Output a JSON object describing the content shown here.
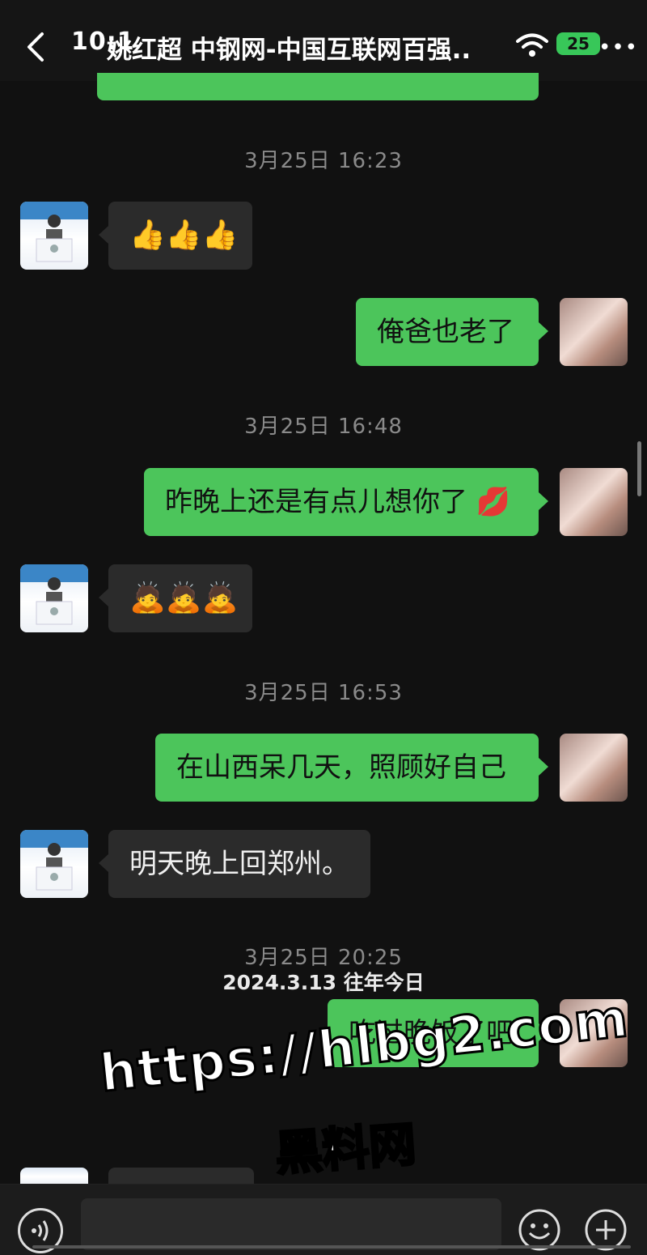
{
  "header": {
    "status_time": "10:1",
    "title": "姚红超 中钢网-中国互联网百强..",
    "battery": "25"
  },
  "colors": {
    "outgoing_bubble": "#4cc55b",
    "incoming_bubble": "#2b2b2b",
    "background": "#111111"
  },
  "messages": {
    "ts1": "3月25日 16:23",
    "m1": "👍👍👍",
    "m2": "俺爸也老了",
    "ts2": "3月25日 16:48",
    "m3": "昨晚上还是有点儿想你了 💋",
    "m4": "🙇🙇🙇",
    "ts3": "3月25日 16:53",
    "m5": "在山西呆几天，照顾好自己",
    "m6": "明天晚上回郑州。",
    "ts4": "3月25日 20:25",
    "memory_tag": "2024.3.13 往年今日",
    "m7": "吃过晚饭了吧"
  },
  "watermark": {
    "line1": "https://hlbg2.com",
    "line2": "黑料网"
  },
  "icons": [
    "back-icon",
    "wifi-icon",
    "more-icon",
    "voice-icon",
    "emoji-icon",
    "plus-icon"
  ]
}
